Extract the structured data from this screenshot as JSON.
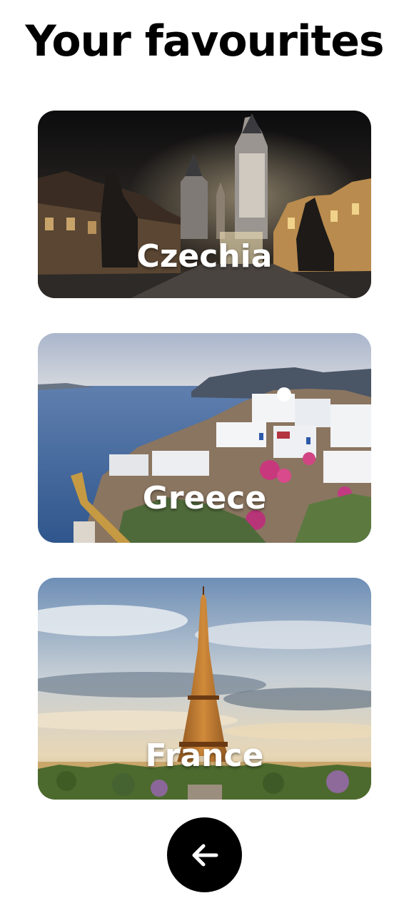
{
  "header": {
    "title": "Your favourites"
  },
  "favourites": [
    {
      "label": "Czechia"
    },
    {
      "label": "Greece"
    },
    {
      "label": "France"
    }
  ],
  "navigation": {
    "back_icon": "arrow-left-icon"
  },
  "colors": {
    "background": "#ffffff",
    "title": "#000000",
    "label": "#ffffff",
    "back_button": "#000000"
  }
}
